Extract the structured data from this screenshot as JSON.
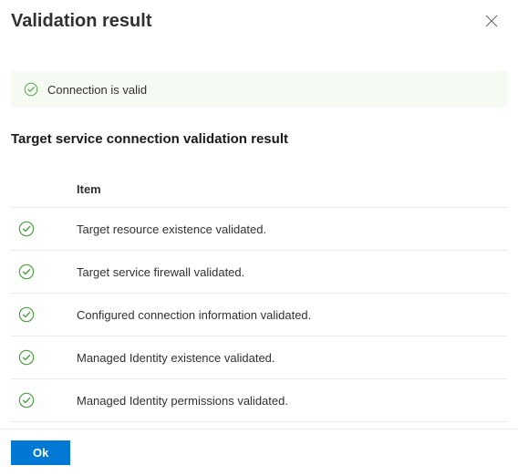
{
  "dialog": {
    "title": "Validation result"
  },
  "banner": {
    "message": "Connection is valid"
  },
  "section": {
    "title": "Target service connection validation result"
  },
  "table": {
    "header": "Item",
    "rows": [
      "Target resource existence validated.",
      "Target service firewall validated.",
      "Configured connection information validated.",
      "Managed Identity existence validated.",
      "Managed Identity permissions validated."
    ]
  },
  "footer": {
    "ok_label": "Ok"
  }
}
